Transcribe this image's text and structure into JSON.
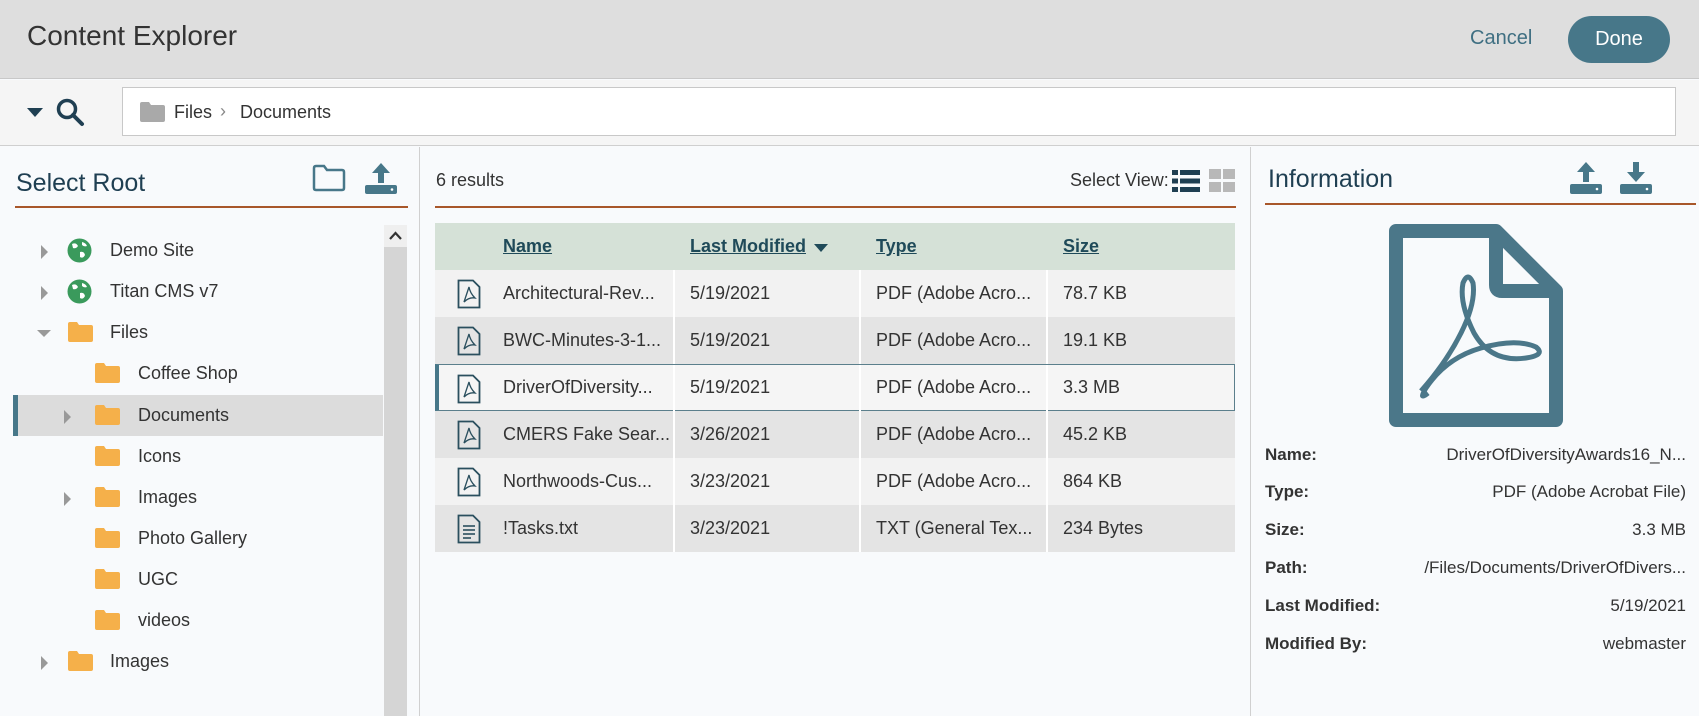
{
  "header": {
    "title": "Content Explorer",
    "cancel_label": "Cancel",
    "done_label": "Done"
  },
  "breadcrumb": {
    "items": [
      "Files",
      "Documents"
    ],
    "separator": "›"
  },
  "left": {
    "title": "Select Root",
    "tree": [
      {
        "label": "Demo Site",
        "icon": "globe-icon",
        "expander": "collapsed",
        "depth": 0
      },
      {
        "label": "Titan CMS v7",
        "icon": "globe-icon",
        "expander": "collapsed",
        "depth": 0
      },
      {
        "label": "Files",
        "icon": "folder-icon",
        "expander": "expanded",
        "depth": 0
      },
      {
        "label": "Coffee Shop",
        "icon": "folder-icon",
        "expander": "none",
        "depth": 1
      },
      {
        "label": "Documents",
        "icon": "folder-icon",
        "expander": "collapsed",
        "depth": 1,
        "selected": true
      },
      {
        "label": "Icons",
        "icon": "folder-icon",
        "expander": "none",
        "depth": 1
      },
      {
        "label": "Images",
        "icon": "folder-icon",
        "expander": "collapsed",
        "depth": 1
      },
      {
        "label": "Photo Gallery",
        "icon": "folder-icon",
        "expander": "none",
        "depth": 1
      },
      {
        "label": "UGC",
        "icon": "folder-icon",
        "expander": "none",
        "depth": 1
      },
      {
        "label": "videos",
        "icon": "folder-icon",
        "expander": "none",
        "depth": 1
      },
      {
        "label": "Images",
        "icon": "folder-icon",
        "expander": "collapsed",
        "depth": 0
      }
    ]
  },
  "middle": {
    "results_count": "6",
    "results_label": "results",
    "select_view_label": "Select View:",
    "columns": [
      "Name",
      "Last Modified",
      "Type",
      "Size"
    ],
    "sort_column": "Last Modified",
    "rows": [
      {
        "icon": "pdf-icon",
        "name": "Architectural-Rev...",
        "modified": "5/19/2021",
        "type": "PDF (Adobe Acro...",
        "size": "78.7 KB"
      },
      {
        "icon": "pdf-icon",
        "name": "BWC-Minutes-3-1...",
        "modified": "5/19/2021",
        "type": "PDF (Adobe Acro...",
        "size": "19.1 KB"
      },
      {
        "icon": "pdf-icon",
        "name": "DriverOfDiversity...",
        "modified": "5/19/2021",
        "type": "PDF (Adobe Acro...",
        "size": "3.3 MB",
        "selected": true
      },
      {
        "icon": "pdf-icon",
        "name": "CMERS Fake Sear...",
        "modified": "3/26/2021",
        "type": "PDF (Adobe Acro...",
        "size": "45.2 KB"
      },
      {
        "icon": "pdf-icon",
        "name": "Northwoods-Cus...",
        "modified": "3/23/2021",
        "type": "PDF (Adobe Acro...",
        "size": "864 KB"
      },
      {
        "icon": "text-file-icon",
        "name": "!Tasks.txt",
        "modified": "3/23/2021",
        "type": "TXT (General Tex...",
        "size": "234 Bytes"
      }
    ]
  },
  "right": {
    "title": "Information",
    "properties": [
      {
        "key": "Name:",
        "value": "DriverOfDiversityAwards16_N..."
      },
      {
        "key": "Type:",
        "value": "PDF (Adobe Acrobat File)"
      },
      {
        "key": "Size:",
        "value": "3.3 MB"
      },
      {
        "key": "Path:",
        "value": "/Files/Documents/DriverOfDivers..."
      },
      {
        "key": "Last Modified:",
        "value": "5/19/2021"
      },
      {
        "key": "Modified By:",
        "value": "webmaster"
      }
    ]
  },
  "colors": {
    "accent": "#477789",
    "rule": "#a8572a",
    "folder": "#f5b04a",
    "globe": "#3a9a5c",
    "heading": "#1f3f52"
  }
}
